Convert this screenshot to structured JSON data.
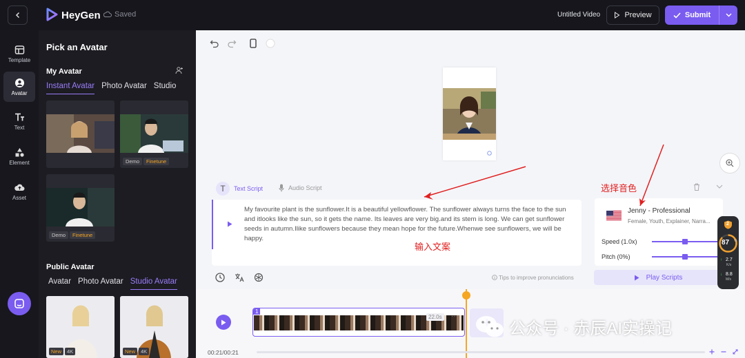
{
  "topbar": {
    "brand": "HeyGen",
    "saved_label": "Saved",
    "video_title": "Untitled Video",
    "preview_label": "Preview",
    "submit_label": "Submit"
  },
  "rail": {
    "items": [
      {
        "label": "Template",
        "icon": "template-icon"
      },
      {
        "label": "Avatar",
        "icon": "avatar-icon",
        "active": true
      },
      {
        "label": "Text",
        "icon": "text-icon"
      },
      {
        "label": "Element",
        "icon": "element-icon"
      },
      {
        "label": "Asset",
        "icon": "asset-icon"
      }
    ]
  },
  "panel": {
    "title": "Pick an Avatar",
    "my_avatar": {
      "title": "My Avatar",
      "tabs": [
        "Instant Avatar",
        "Photo Avatar",
        "Studio"
      ],
      "active_tab": 0,
      "cards": [
        {
          "badges": []
        },
        {
          "badges": [
            "Demo",
            "Finetune"
          ]
        },
        {
          "badges": [
            "Demo",
            "Finetune"
          ]
        }
      ]
    },
    "public_avatar": {
      "title": "Public Avatar",
      "tabs": [
        "Avatar",
        "Photo Avatar",
        "Studio Avatar"
      ],
      "active_tab": 2,
      "cards": [
        {
          "badges": [
            "New",
            "4K"
          ]
        },
        {
          "badges": [
            "New",
            "4K"
          ]
        }
      ]
    }
  },
  "script": {
    "tabs": [
      "Text Script",
      "Audio Script"
    ],
    "active_tab": 0,
    "text": "My favourite plant is the sunflower.It is a beautiful yellowflower. The sunflower always turns the face to the sun and itlooks like the sun, so it gets the name. Its leaves are very big.and its stem is long. We can get sunflower seeds in autumn.Ilike sunflowers because they mean hope for the future.Whenwe see sunflowers, we will be happy.",
    "tips": "Tips to improve pronunciations"
  },
  "voice": {
    "name": "Jenny - Professional",
    "description": "Female, Youth, Explainer, Narra...",
    "speed_label": "Speed (1.0x)",
    "speed_value": 1.0,
    "pitch_label": "Pitch (0%)",
    "pitch_value": 0,
    "play_label": "Play Scripts"
  },
  "annotations": {
    "voice_select": "选择音色",
    "input_text": "输入文案"
  },
  "timeline": {
    "clip_number": "1",
    "clip_duration": "22.0s",
    "time_display": "00:21/00:21"
  },
  "widget": {
    "level": "2",
    "percent": "87",
    "percent_sign": "%",
    "up_value": "2.7",
    "up_unit": "K/s",
    "down_value": "8.8",
    "down_unit": "M/s"
  },
  "watermark": "公众号 · 赤辰AI实操记",
  "colors": {
    "accent": "#7a5cf0",
    "topbar": "#16161c",
    "playhead": "#f5a623",
    "annotation": "#e02020"
  }
}
